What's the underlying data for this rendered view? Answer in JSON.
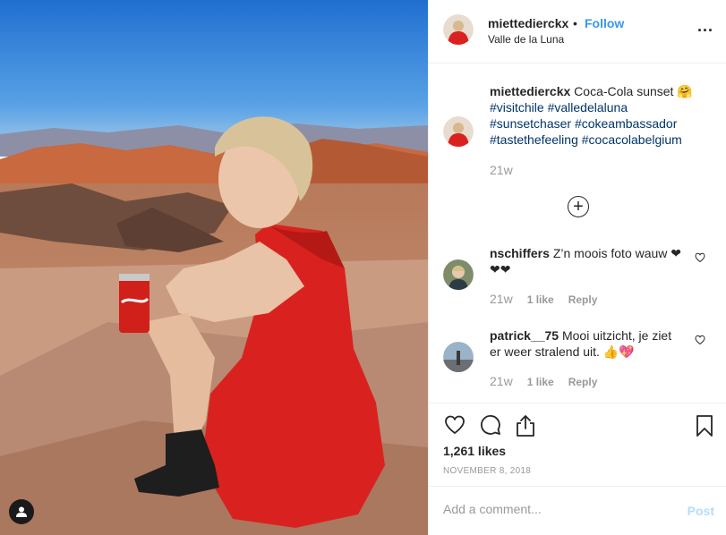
{
  "header": {
    "username": "miettedierckx",
    "dot": "•",
    "follow_label": "Follow",
    "location": "Valle de la Luna",
    "more_label": "..."
  },
  "caption": {
    "username": "miettedierckx",
    "text": "Coca-Cola sunset 🤗",
    "hashtags": [
      "#visitchile",
      "#valledelaluna",
      "#sunsetchaser",
      "#cokeambassador",
      "#tastethefeeling",
      "#cocacolabelgium"
    ],
    "time": "21w"
  },
  "more_comments_icon": "plus-circle-icon",
  "comments": [
    {
      "username": "nschiffers",
      "text": "Z’n moois foto wauw ❤❤❤",
      "time": "21w",
      "likes": "1 like",
      "reply_label": "Reply"
    },
    {
      "username": "patrick__75",
      "text": "Mooi uitzicht, je ziet er weer stralend uit. 👍💖",
      "time": "21w",
      "likes": "1 like",
      "reply_label": "Reply"
    }
  ],
  "actions": {
    "icons": [
      "heart-icon",
      "comment-icon",
      "share-icon",
      "bookmark-icon"
    ],
    "likes": "1,261 likes",
    "date": "NOVEMBER 8, 2018"
  },
  "add_comment": {
    "placeholder": "Add a comment...",
    "post_label": "Post"
  },
  "colors": {
    "link": "#3897f0",
    "hashtag": "#003569",
    "muted": "#999999",
    "post_disabled": "#b2dffc",
    "dress": "#d9221f"
  }
}
